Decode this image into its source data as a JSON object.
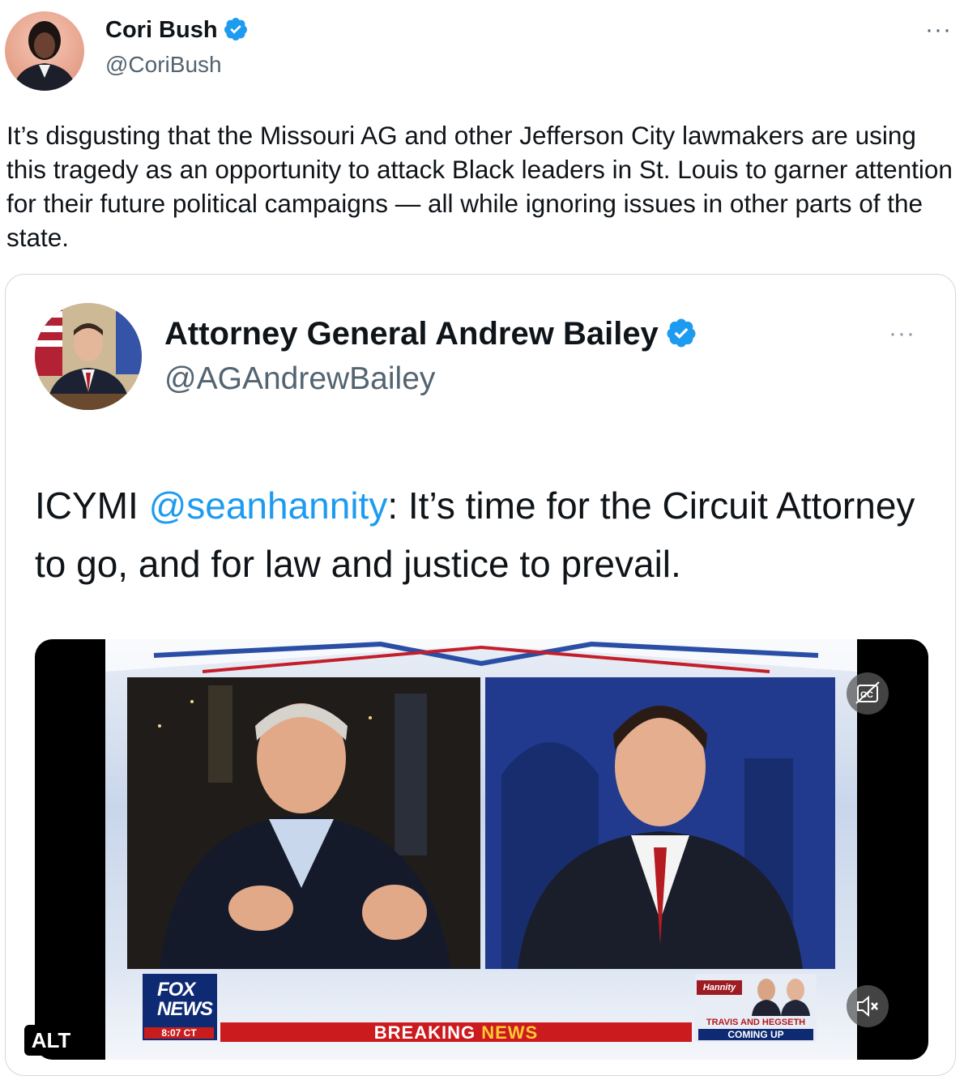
{
  "outer_tweet": {
    "author_name": "Cori Bush",
    "author_handle": "@CoriBush",
    "more_label": "···",
    "text": "It’s disgusting that the Missouri AG and other Jefferson City lawmakers are using this tragedy as an opportunity to attack Black leaders in St. Louis to garner attention for their future political campaigns — all while ignoring issues in other parts of the state."
  },
  "quoted_tweet": {
    "author_name": "Attorney General Andrew Bailey",
    "author_handle": "@AGAndrewBailey",
    "more_label": "···",
    "text_prefix": "ICYMI ",
    "mention": "@seanhannity",
    "text_suffix": ": It’s time for the Circuit Attorney to go, and for law and justice to prevail."
  },
  "video": {
    "alt_label": "ALT",
    "fox_line1": "FOX",
    "fox_line2": "NEWS",
    "broadcast_time": "8:07 CT",
    "banner_word1": "BREAKING",
    "banner_word2": "NEWS",
    "promo_show": "Hannity",
    "promo_line1": "TRAVIS AND HEGSETH",
    "promo_line2": "COMING UP",
    "muted": true,
    "captions_icon": "captions-icon",
    "volume_icon": "volume-muted-icon"
  },
  "colors": {
    "verified_blue": "#1d9bf0",
    "link_blue": "#1d9bf0",
    "text_primary": "#0f1419",
    "text_secondary": "#536471",
    "fox_navy": "#0d2a73",
    "breaking_red": "#cc1b1f"
  }
}
